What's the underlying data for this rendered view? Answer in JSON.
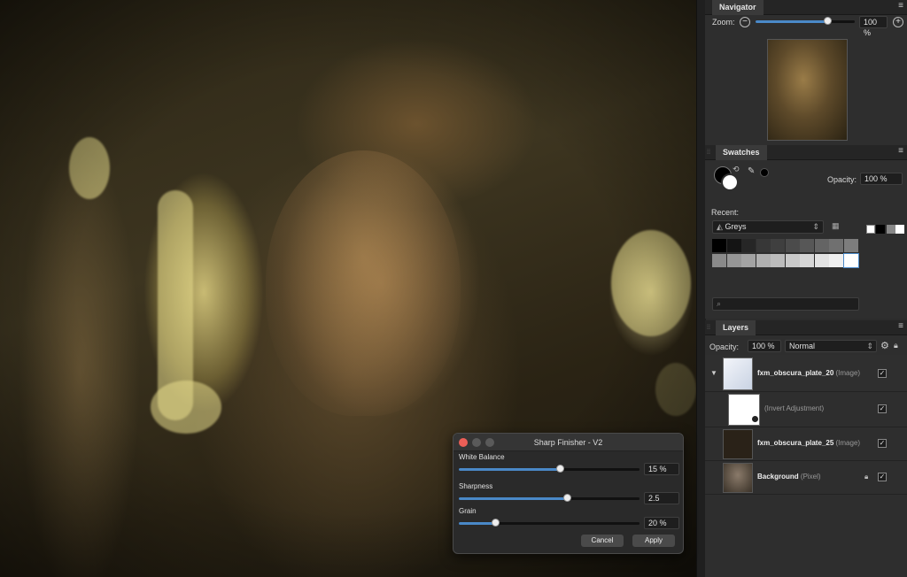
{
  "navigator": {
    "title": "Navigator",
    "zoom_label": "Zoom:",
    "zoom_value": "100 %",
    "zoom_level_fraction": 0.72,
    "zoom_out_glyph": "−",
    "zoom_in_glyph": "+"
  },
  "swatches": {
    "title": "Swatches",
    "opacity_label": "Opacity:",
    "opacity_value": "100 %",
    "recent_label": "Recent:",
    "palette_name": "Greys",
    "search_icon": "search-icon",
    "palette_colors": [
      "#000000",
      "#141414",
      "#262626",
      "#373737",
      "#3f3f3f",
      "#4b4b4b",
      "#575757",
      "#646464",
      "#707070",
      "#7d7d7d",
      "#8a8a8a",
      "#969696",
      "#a3a3a3",
      "#b0b0b0",
      "#bcbcbc",
      "#c9c9c9",
      "#d6d6d6",
      "#e2e2e2",
      "#efefef",
      "#ffffff"
    ]
  },
  "layers": {
    "title": "Layers",
    "opacity_label": "Opacity:",
    "opacity_value": "100 %",
    "blend_mode": "Normal",
    "items": [
      {
        "name": "fxm_obscura_plate_20",
        "type": "(Image)"
      },
      {
        "name": "",
        "type": "(Invert Adjustment)"
      },
      {
        "name": "fxm_obscura_plate_25",
        "type": "(Image)"
      },
      {
        "name": "Background",
        "type": "(Pixel)"
      }
    ]
  },
  "dialog": {
    "title": "Sharp Finisher - V2",
    "white_balance_label": "White Balance",
    "white_balance_value": "15 %",
    "white_balance_level": 0.56,
    "sharpness_label": "Sharpness",
    "sharpness_value": "2.5",
    "sharpness_level": 0.6,
    "grain_label": "Grain",
    "grain_value": "20 %",
    "grain_level": 0.2,
    "cancel_label": "Cancel",
    "apply_label": "Apply"
  },
  "colors": {
    "accent": "#4a89c8",
    "close": "#ec5f57"
  }
}
